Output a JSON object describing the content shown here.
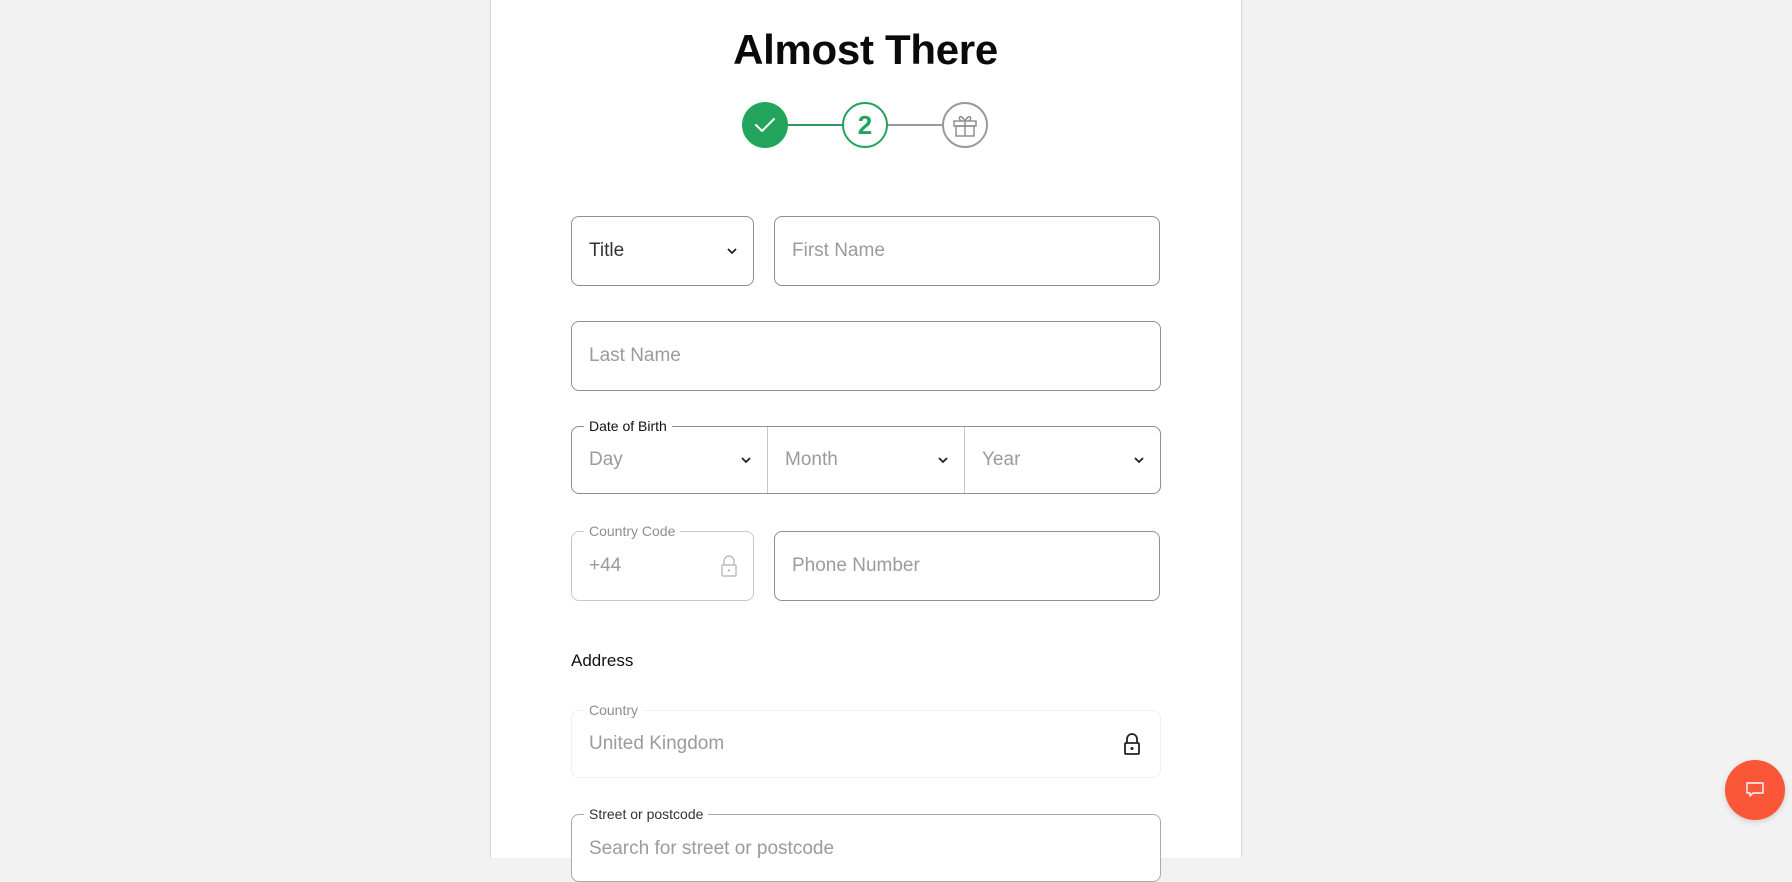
{
  "page": {
    "title": "Almost There"
  },
  "stepper": {
    "steps": [
      {
        "state": "completed",
        "icon": "check-icon"
      },
      {
        "state": "current",
        "label": "2"
      },
      {
        "state": "upcoming",
        "icon": "gift-icon"
      }
    ]
  },
  "form": {
    "title_select": {
      "value": "Title"
    },
    "first_name": {
      "placeholder": "First Name"
    },
    "last_name": {
      "placeholder": "Last Name"
    },
    "date_of_birth": {
      "legend": "Date of Birth",
      "day": {
        "placeholder": "Day"
      },
      "month": {
        "placeholder": "Month"
      },
      "year": {
        "placeholder": "Year"
      }
    },
    "country_code": {
      "legend": "Country Code",
      "value": "+44",
      "locked": true
    },
    "phone_number": {
      "placeholder": "Phone Number"
    },
    "address": {
      "heading": "Address",
      "country": {
        "legend": "Country",
        "value": "United Kingdom",
        "locked": true
      },
      "street": {
        "legend": "Street or postcode",
        "placeholder": "Search for street or postcode"
      }
    }
  },
  "colors": {
    "accent_green": "#22a45d",
    "chat_button": "#f95738",
    "background": "#f2f2f2"
  },
  "chat": {
    "icon": "chat-bubble-icon"
  }
}
